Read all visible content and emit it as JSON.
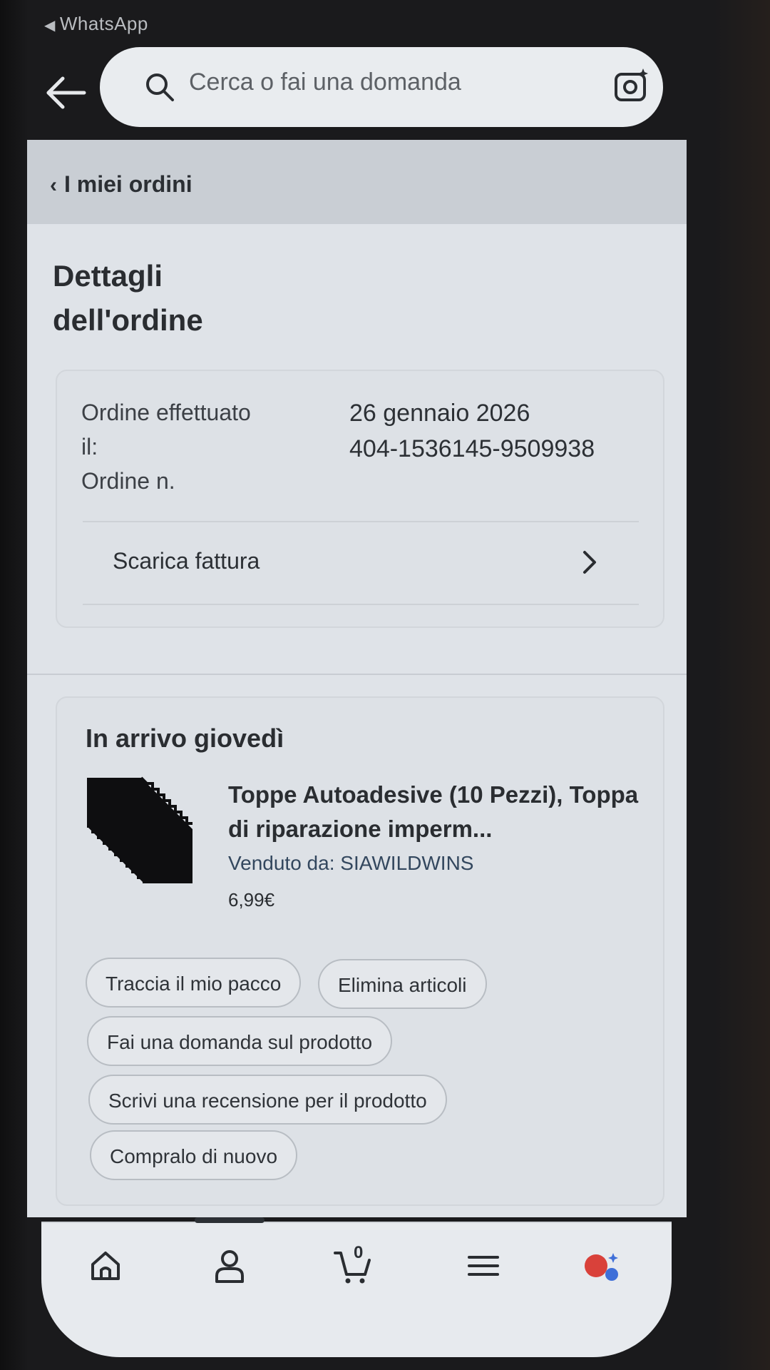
{
  "status_bar": {
    "back_app": "WhatsApp"
  },
  "search": {
    "placeholder": "Cerca o fai una domanda"
  },
  "breadcrumb": {
    "label": "I miei ordini"
  },
  "page": {
    "title": "Dettagli dell'ordine"
  },
  "order_info": {
    "date_label": "Ordine effettuato il:",
    "number_label": "Ordine n.",
    "date_value": "26 gennaio 2026",
    "number_value": "404-1536145-9509938",
    "invoice_label": "Scarica fattura"
  },
  "shipment": {
    "status": "In arrivo giovedì",
    "product_title": "Toppe Autoadesive (10 Pezzi), Toppa di riparazione imperm...",
    "seller_prefix": "Venduto da: ",
    "seller_name": "SIAWILDWINS",
    "price": "6,99€",
    "actions": {
      "track": "Traccia il mio pacco",
      "delete": "Elimina articoli",
      "ask": "Fai una domanda sul prodotto",
      "review": "Scrivi una recensione per il prodotto",
      "buy_again": "Compralo di nuovo"
    }
  },
  "bottom_nav": {
    "items": [
      "home-icon",
      "account-icon",
      "cart-icon",
      "menu-icon",
      "assistant-icon"
    ],
    "cart_count": "0",
    "active_item": "account-icon"
  },
  "colors": {
    "assistant_red": "#d9413a",
    "assistant_blue": "#3f6fd8"
  }
}
